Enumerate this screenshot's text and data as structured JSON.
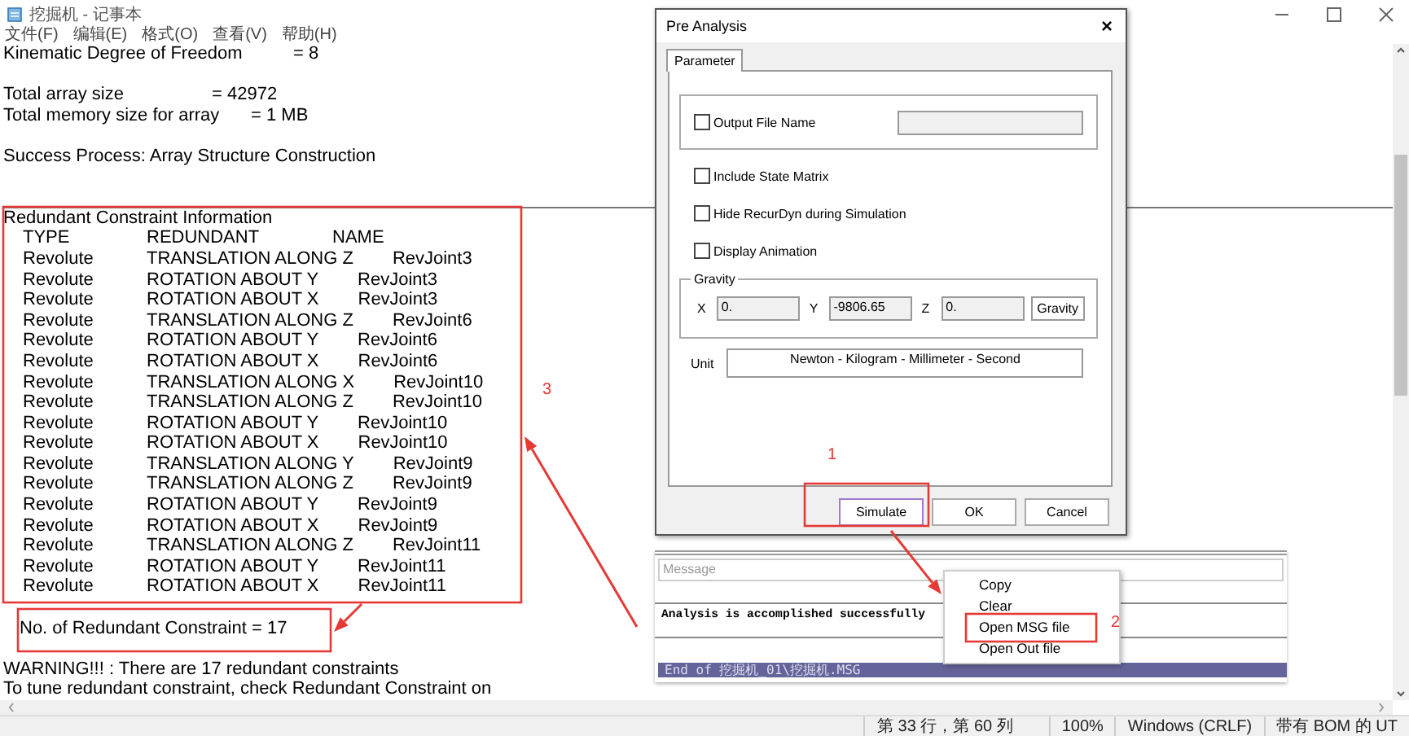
{
  "notepad": {
    "title": "挖掘机 - 记事本",
    "menu": [
      "文件(F)",
      "编辑(E)",
      "格式(O)",
      "查看(V)",
      "帮助(H)"
    ],
    "lines": [
      {
        "kind": "pair",
        "label": "Kinematic Degree of Freedom",
        "value": "= 8"
      },
      {
        "kind": "blank"
      },
      {
        "kind": "pair",
        "label": "Total array size",
        "value": "= 42972"
      },
      {
        "kind": "pair",
        "label": "Total memory size for array",
        "value": "= 1 MB"
      },
      {
        "kind": "blank"
      },
      {
        "kind": "text",
        "text": "Success Process: Array Structure Construction"
      },
      {
        "kind": "blank"
      },
      {
        "kind": "rule"
      }
    ],
    "redundant": {
      "title": "Redundant Constraint Information",
      "columns": [
        "TYPE",
        "REDUNDANT",
        "NAME"
      ],
      "rows": [
        {
          "type": "Revolute",
          "redundant": "TRANSLATION ALONG Z",
          "name": "RevJoint3"
        },
        {
          "type": "Revolute",
          "redundant": "ROTATION ABOUT Y",
          "name": "RevJoint3"
        },
        {
          "type": "Revolute",
          "redundant": "ROTATION ABOUT X",
          "name": "RevJoint3"
        },
        {
          "type": "Revolute",
          "redundant": "TRANSLATION ALONG Z",
          "name": "RevJoint6"
        },
        {
          "type": "Revolute",
          "redundant": "ROTATION ABOUT Y",
          "name": "RevJoint6"
        },
        {
          "type": "Revolute",
          "redundant": "ROTATION ABOUT X",
          "name": "RevJoint6"
        },
        {
          "type": "Revolute",
          "redundant": "TRANSLATION ALONG X",
          "name": "RevJoint10"
        },
        {
          "type": "Revolute",
          "redundant": "TRANSLATION ALONG Z",
          "name": "RevJoint10"
        },
        {
          "type": "Revolute",
          "redundant": "ROTATION ABOUT Y",
          "name": "RevJoint10"
        },
        {
          "type": "Revolute",
          "redundant": "ROTATION ABOUT X",
          "name": "RevJoint10"
        },
        {
          "type": "Revolute",
          "redundant": "TRANSLATION ALONG Y",
          "name": "RevJoint9"
        },
        {
          "type": "Revolute",
          "redundant": "TRANSLATION ALONG Z",
          "name": "RevJoint9"
        },
        {
          "type": "Revolute",
          "redundant": "ROTATION ABOUT Y",
          "name": "RevJoint9"
        },
        {
          "type": "Revolute",
          "redundant": "ROTATION ABOUT X",
          "name": "RevJoint9"
        },
        {
          "type": "Revolute",
          "redundant": "TRANSLATION ALONG Z",
          "name": "RevJoint11"
        },
        {
          "type": "Revolute",
          "redundant": "ROTATION ABOUT Y",
          "name": "RevJoint11"
        },
        {
          "type": "Revolute",
          "redundant": "ROTATION ABOUT X",
          "name": "RevJoint11"
        }
      ],
      "count": "No. of Redundant Constraint = 17"
    },
    "tail": [
      "WARNING!!! : There are 17 redundant constraints",
      "To tune redundant constraint, check Redundant Constraint on"
    ],
    "status_bar": [
      "第 33 行，第 60 列",
      "100%",
      "Windows (CRLF)",
      "带有 BOM 的 UT"
    ]
  },
  "dialog": {
    "title": "Pre Analysis",
    "close": "×",
    "tab": "Parameter",
    "output_file": {
      "label": "Output File Name",
      "checked": false
    },
    "options": [
      {
        "label": "Include State Matrix",
        "checked": false
      },
      {
        "label": "Hide RecurDyn during Simulation",
        "checked": false
      },
      {
        "label": "Display Animation",
        "checked": false
      }
    ],
    "gravity": {
      "title": "Gravity",
      "fields": [
        {
          "label": "X",
          "value": "0."
        },
        {
          "label": "Y",
          "value": "-9806.65"
        },
        {
          "label": "Z",
          "value": "0."
        }
      ],
      "button": "Gravity"
    },
    "unit": {
      "label": "Unit",
      "value": "Newton - Kilogram - Millimeter - Second"
    },
    "buttons": [
      {
        "label": "Simulate",
        "focused": true
      },
      {
        "label": "OK",
        "focused": false
      },
      {
        "label": "Cancel",
        "focused": false
      }
    ]
  },
  "message_panel": {
    "header": "Message",
    "text": "Analysis is accomplished successfully",
    "footer": "End of 挖掘机_01\\挖掘机.MSG"
  },
  "context_menu": [
    "Copy",
    "Clear",
    "Open MSG file",
    "Open Out file"
  ],
  "annotations": [
    "1",
    "2",
    "3"
  ]
}
